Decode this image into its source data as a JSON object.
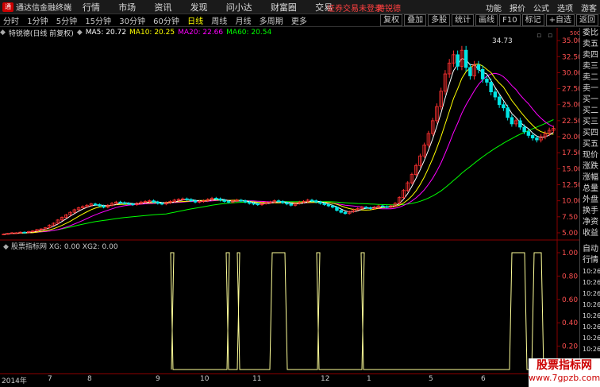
{
  "titlebar": {
    "app_name": "通达信金融终端",
    "menus": [
      "行情",
      "市场",
      "资讯",
      "发现",
      "问小达",
      "财富圈",
      "交易"
    ],
    "notice": "证券交易未登录",
    "notice2": "特锐德",
    "right": [
      "功能",
      "报价",
      "公式",
      "选项",
      "游客"
    ]
  },
  "toolbar": {
    "timeframes": [
      "分时",
      "1分钟",
      "5分钟",
      "15分钟",
      "30分钟",
      "60分钟",
      "日线",
      "周线",
      "月线",
      "多周期",
      "更多"
    ],
    "active": "日线",
    "right_buttons": [
      "复权",
      "叠加",
      "多股",
      "统计",
      "画线",
      "F10",
      "标记",
      "+自选",
      "返回"
    ]
  },
  "infobar": {
    "stock": "特锐德(日线 前复权)",
    "ma5": "MA5: 20.72",
    "ma10": "MA10: 20.25",
    "ma20": "MA20: 22.66",
    "ma60": "MA60: 20.54"
  },
  "indicator": {
    "label": "股票指标网 XG: 0.00 XG2: 0.00"
  },
  "price_axis": [
    "35.00",
    "32.50",
    "30.00",
    "27.50",
    "25.00",
    "22.50",
    "20.00",
    "17.50",
    "15.00",
    "12.50",
    "10.00",
    "7.50",
    "5.00"
  ],
  "indicator_axis": [
    "1.00",
    "0.80",
    "0.60",
    "0.40",
    "0.20"
  ],
  "peak_label": "34.73",
  "unit_label": "500",
  "right_panel": [
    "委比",
    "卖五",
    "卖四",
    "卖三",
    "卖二",
    "卖一",
    "买一",
    "买二",
    "买三",
    "买四",
    "买五",
    "现价",
    "涨跌",
    "涨幅",
    "总量",
    "外盘",
    "换手",
    "净资",
    "收益"
  ],
  "right_panel2": [
    "自动",
    "行情",
    "10:26",
    "10:26",
    "10:26",
    "10:26",
    "10:26",
    "10:26",
    "10:26",
    "10:26",
    "10:26",
    "10:26"
  ],
  "time_axis": [
    "2014年",
    "7",
    "8",
    "9",
    "10",
    "11",
    "12",
    "1",
    "5",
    "6"
  ],
  "watermark": {
    "line1": "股票指标网",
    "line2": "www.7gpzb.com"
  },
  "colors": {
    "up": "#ff3030",
    "down": "#00e5e5",
    "ma5": "#ffffff",
    "ma10": "#ffff00",
    "ma20": "#ff00ff",
    "ma60": "#00ff00"
  },
  "chart_data": {
    "type": "line",
    "price_range": [
      4.5,
      36.5
    ],
    "closes": [
      4.8,
      4.9,
      5.0,
      5.0,
      5.1,
      5.0,
      5.2,
      5.3,
      5.5,
      5.6,
      5.8,
      6.2,
      6.5,
      7.0,
      7.4,
      7.8,
      8.2,
      8.6,
      8.9,
      9.1,
      9.3,
      9.5,
      9.4,
      9.2,
      9.0,
      9.3,
      9.6,
      9.8,
      9.7,
      9.6,
      9.5,
      9.4,
      9.6,
      9.8,
      9.9,
      10.0,
      9.8,
      9.6,
      9.5,
      9.7,
      9.9,
      10.1,
      10.2,
      10.3,
      10.2,
      10.0,
      9.8,
      9.9,
      10.0,
      10.2,
      10.4,
      10.3,
      10.1,
      9.9,
      9.8,
      10.0,
      10.1,
      10.0,
      9.8,
      9.6,
      9.5,
      9.4,
      9.6,
      9.7,
      9.8,
      10.0,
      9.9,
      9.7,
      9.5,
      9.3,
      9.6,
      9.8,
      9.9,
      10.1,
      10.0,
      9.8,
      9.6,
      9.4,
      9.2,
      9.0,
      8.5,
      8.2,
      8.0,
      8.3,
      8.6,
      8.8,
      9.0,
      8.9,
      8.8,
      9.0,
      9.2,
      9.1,
      9.0,
      9.2,
      9.6,
      10.5,
      11.6,
      12.8,
      14.1,
      15.5,
      17.0,
      18.7,
      20.5,
      22.5,
      24.7,
      27.1,
      29.8,
      31.5,
      32.8,
      31.0,
      33.5,
      30.8,
      29.5,
      31.2,
      30.5,
      29.0,
      28.5,
      27.0,
      26.2,
      25.0,
      24.5,
      23.0,
      22.0,
      22.5,
      21.5,
      20.8,
      20.2,
      19.8,
      19.5,
      20.0,
      20.5,
      21.0,
      21.3
    ]
  }
}
